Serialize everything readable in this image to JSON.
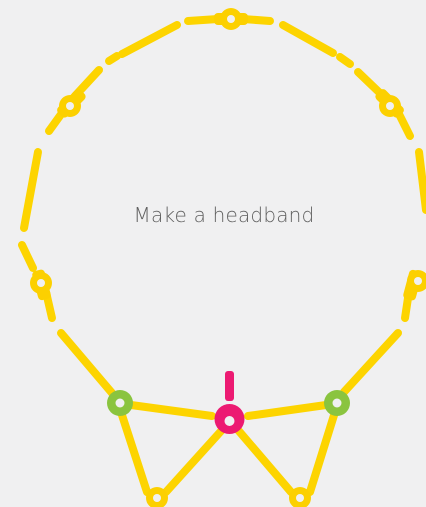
{
  "caption": "Make a headband",
  "colors": {
    "background": "#f0f0f1",
    "stick": "#fdd400",
    "stick_edge": "#e8c100",
    "connector_yellow": "#fcd000",
    "connector_green": "#8ac43f",
    "connector_pink": "#ec1a72",
    "text": "#606060"
  }
}
